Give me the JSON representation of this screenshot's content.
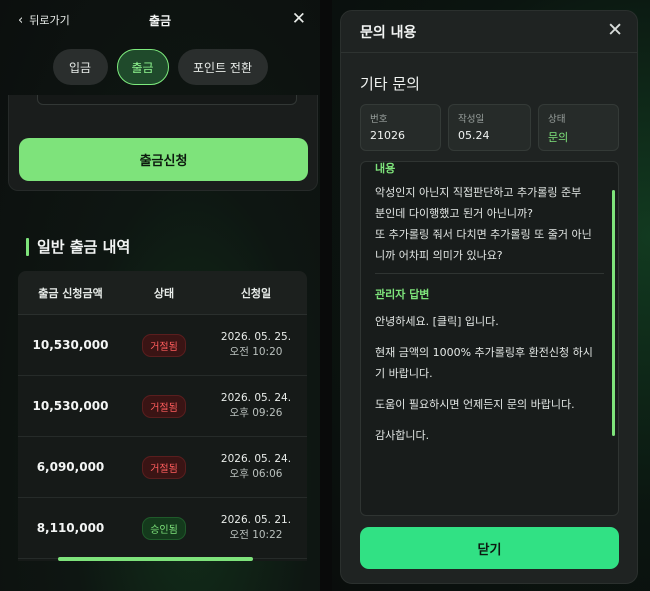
{
  "left": {
    "back_label": "뒤로가기",
    "title": "출금",
    "close_icon": "✕",
    "tabs": [
      {
        "label": "입금",
        "active": false
      },
      {
        "label": "출금",
        "active": true
      },
      {
        "label": "포인트 전환",
        "active": false
      }
    ],
    "apply_button": "출금신청",
    "section_title": "일반 출금 내역",
    "table": {
      "headers": [
        "출금 신청금액",
        "상태",
        "신청일"
      ],
      "rows": [
        {
          "amount": "10,530,000",
          "status": "거절됨",
          "status_type": "rejected",
          "date": "2026. 05. 25.",
          "time": "오전 10:20"
        },
        {
          "amount": "10,530,000",
          "status": "거절됨",
          "status_type": "rejected",
          "date": "2026. 05. 24.",
          "time": "오후 09:26"
        },
        {
          "amount": "6,090,000",
          "status": "거절됨",
          "status_type": "rejected",
          "date": "2026. 05. 24.",
          "time": "오후 06:06"
        },
        {
          "amount": "8,110,000",
          "status": "승인됨",
          "status_type": "approved",
          "date": "2026. 05. 21.",
          "time": "오전 10:22"
        }
      ]
    }
  },
  "modal": {
    "title": "문의 내용",
    "close_icon": "✕",
    "subtitle": "기타 문의",
    "info": [
      {
        "label": "번호",
        "value": "21026"
      },
      {
        "label": "작성일",
        "value": "05.24"
      },
      {
        "label": "상태",
        "value": "문의"
      }
    ],
    "content_label": "내용",
    "question_lines": [
      "악성인지 아닌지 직접판단하고 추가롤링 준부",
      "분인데 다이행했고 된거 아닌니까?",
      "또 추가롤링 줘서 다치면 추가롤링 또 줄거 아닌",
      "니까 어차피 의미가 있나요?"
    ],
    "answer_label": "관리자 답변",
    "answer_lines": [
      "안녕하세요. [클릭] 입니다.",
      "",
      "현재 금액의 1000% 추가롤링후 환전신청 하시",
      "기 바랍니다.",
      "",
      "도움이 필요하시면 언제든지 문의 바랍니다.",
      "",
      "감사합니다."
    ],
    "confirm_button": "닫기"
  },
  "colors": {
    "accent_green": "#7ee37b",
    "confirm_green": "#31e184",
    "reject_red": "#ff5d5d"
  }
}
